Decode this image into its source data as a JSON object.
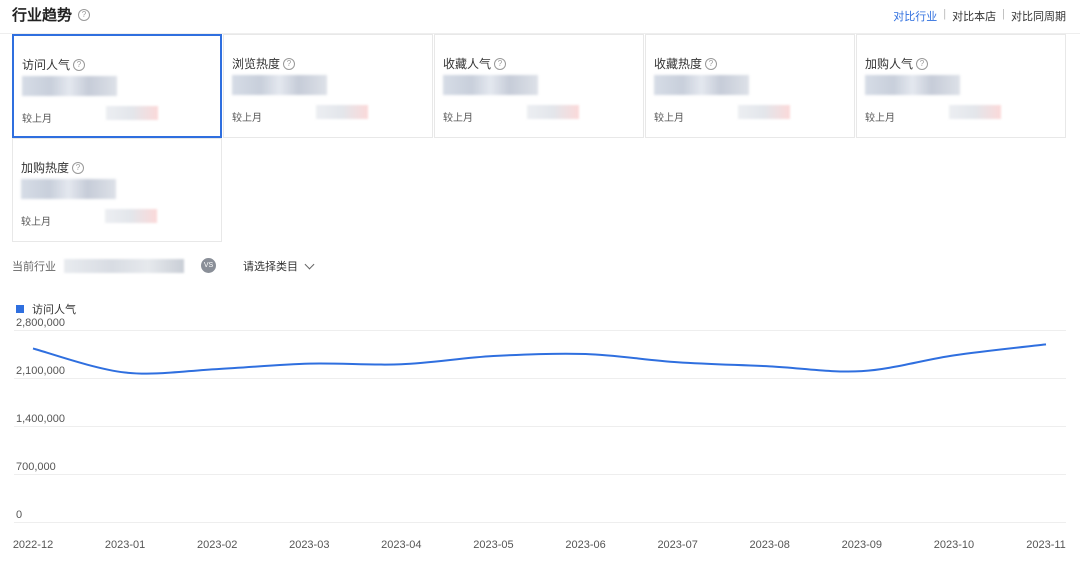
{
  "header": {
    "title": "行业趋势",
    "compare": [
      "对比行业",
      "对比本店",
      "对比同周期"
    ],
    "compare_active_index": 0,
    "accent": "#2f6fdf"
  },
  "cards": [
    {
      "name": "访问人气",
      "mom_label": "较上月",
      "selected": true
    },
    {
      "name": "浏览热度",
      "mom_label": "较上月",
      "selected": false
    },
    {
      "name": "收藏人气",
      "mom_label": "较上月",
      "selected": false
    },
    {
      "name": "收藏热度",
      "mom_label": "较上月",
      "selected": false
    },
    {
      "name": "加购人气",
      "mom_label": "较上月",
      "selected": false
    },
    {
      "name": "加购热度",
      "mom_label": "较上月",
      "selected": false
    }
  ],
  "filters": {
    "industry_label": "当前行业",
    "vs_label": "VS",
    "category_placeholder": "请选择类目"
  },
  "chart_data": {
    "type": "line",
    "categories": [
      "2022-12",
      "2023-01",
      "2023-02",
      "2023-03",
      "2023-04",
      "2023-05",
      "2023-06",
      "2023-07",
      "2023-08",
      "2023-09",
      "2023-10",
      "2023-11"
    ],
    "series": [
      {
        "name": "访问人气",
        "color": "#2f6fdf",
        "values": [
          2530000,
          2180000,
          2230000,
          2310000,
          2300000,
          2420000,
          2450000,
          2330000,
          2270000,
          2200000,
          2430000,
          2590000
        ]
      }
    ],
    "yticks": [
      0,
      700000,
      1400000,
      2100000,
      2800000
    ],
    "ytick_labels": [
      "0",
      "700,000",
      "1,400,000",
      "2,100,000",
      "2,800,000"
    ],
    "ylim": [
      0,
      2800000
    ],
    "grid": true,
    "legend_position": "top-left"
  }
}
